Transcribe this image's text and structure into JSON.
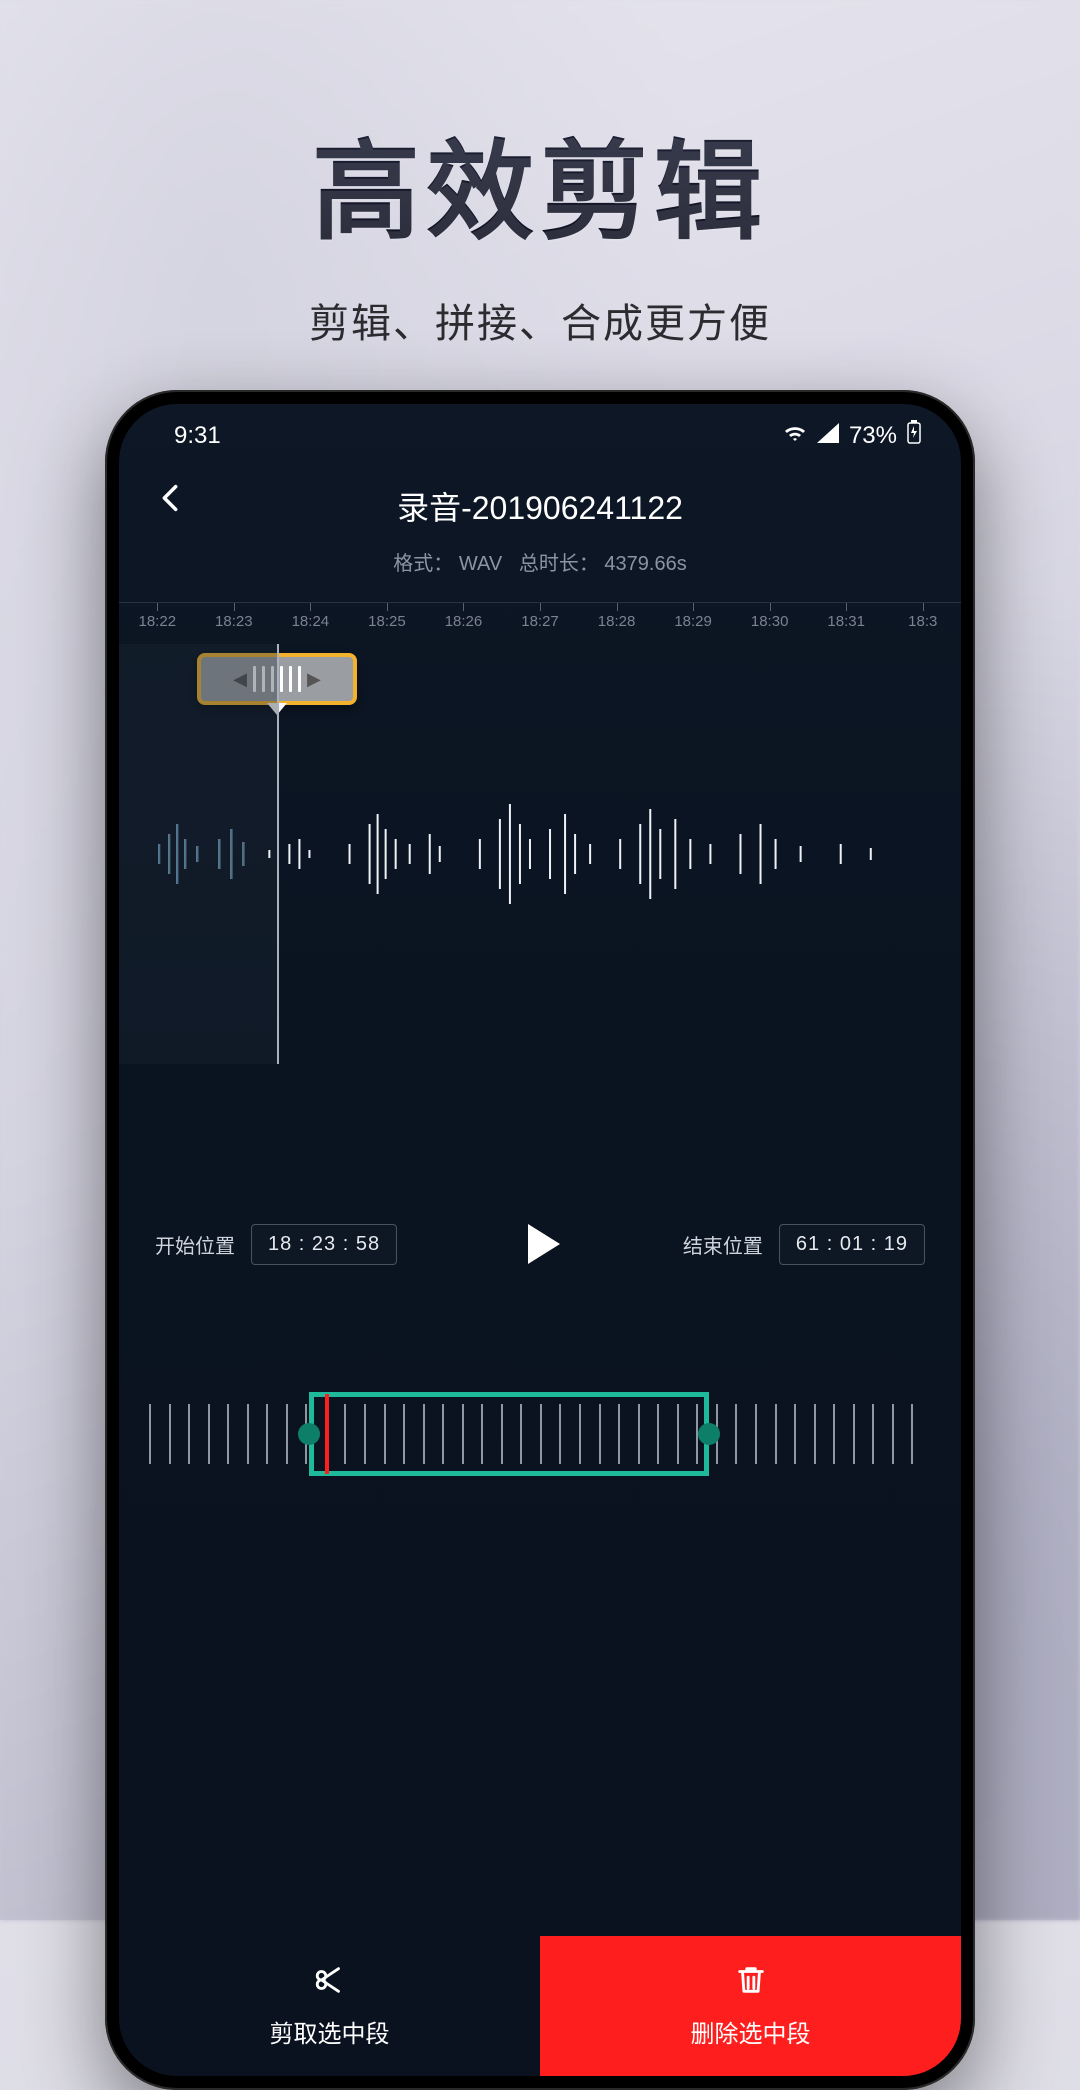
{
  "hero": {
    "title": "高效剪辑",
    "subtitle": "剪辑、拼接、合成更方便"
  },
  "status": {
    "time": "9:31",
    "battery": "73%"
  },
  "appbar": {
    "title": "录音-201906241122"
  },
  "info": {
    "format_label": "格式：",
    "format_value": "WAV",
    "duration_label": "总时长：",
    "duration_value": "4379.66s"
  },
  "ruler": [
    "18:22",
    "18:23",
    "18:24",
    "18:25",
    "18:26",
    "18:27",
    "18:28",
    "18:29",
    "18:30",
    "18:31",
    "18:3"
  ],
  "controls": {
    "start_label": "开始位置",
    "start_value": "18 : 23 : 58",
    "end_label": "结束位置",
    "end_value": "61 : 01 : 19"
  },
  "actions": {
    "cut": "剪取选中段",
    "delete": "删除选中段"
  }
}
